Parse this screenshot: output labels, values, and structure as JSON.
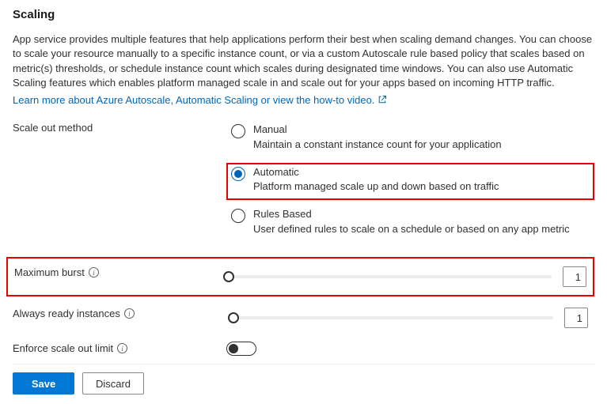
{
  "heading": "Scaling",
  "description": "App service provides multiple features that help applications perform their best when scaling demand changes. You can choose to scale your resource manually to a specific instance count, or via a custom Autoscale rule based policy that scales based on metric(s) thresholds, or schedule instance count which scales during designated time windows. You can also use Automatic Scaling features which enables platform managed scale in and scale out for your apps based on incoming HTTP traffic.",
  "learn_more_link": "Learn more about Azure Autoscale, Automatic Scaling or view the how-to video.",
  "scale_out_method": {
    "label": "Scale out method",
    "options": [
      {
        "label": "Manual",
        "desc": "Maintain a constant instance count for your application",
        "checked": false,
        "highlighted": false
      },
      {
        "label": "Automatic",
        "desc": "Platform managed scale up and down based on traffic",
        "checked": true,
        "highlighted": true
      },
      {
        "label": "Rules Based",
        "desc": "User defined rules to scale on a schedule or based on any app metric",
        "checked": false,
        "highlighted": false
      }
    ]
  },
  "maximum_burst": {
    "label": "Maximum burst",
    "value": "1",
    "highlighted": true
  },
  "always_ready": {
    "label": "Always ready instances",
    "value": "1",
    "highlighted": false
  },
  "enforce_limit": {
    "label": "Enforce scale out limit",
    "enabled": false
  },
  "buttons": {
    "save": "Save",
    "discard": "Discard"
  }
}
